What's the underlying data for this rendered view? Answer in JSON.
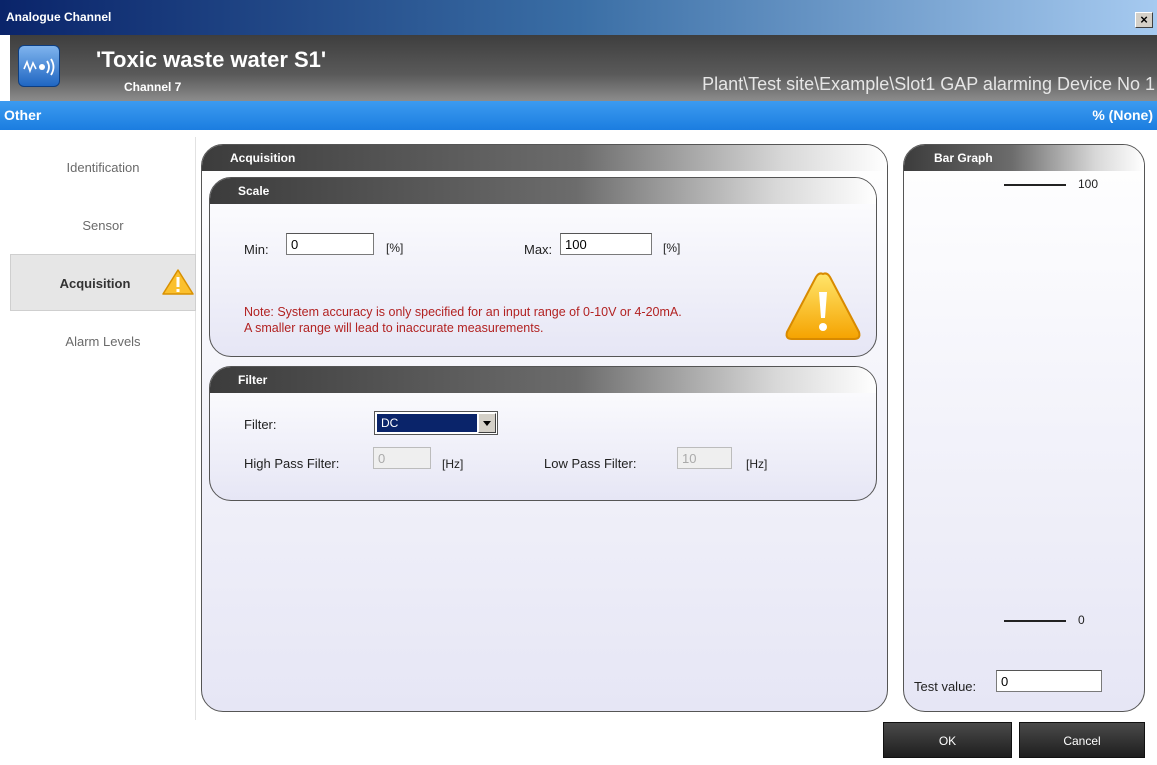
{
  "window": {
    "title": "Analogue Channel",
    "close_label": "×"
  },
  "header": {
    "channel_name": "'Toxic waste water S1'",
    "channel_number": "Channel 7",
    "path": "Plant\\Test site\\Example\\Slot1 GAP alarming Device No 1"
  },
  "subbar": {
    "left": "Other",
    "right": "% (None)"
  },
  "sidebar": {
    "items": [
      {
        "label": "Identification"
      },
      {
        "label": "Sensor"
      },
      {
        "label": "Acquisition",
        "active": true,
        "warning": true
      },
      {
        "label": "Alarm Levels"
      }
    ]
  },
  "acquisition": {
    "title": "Acquisition",
    "scale": {
      "title": "Scale",
      "min_label": "Min:",
      "min_value": "0",
      "min_unit": "[%]",
      "max_label": "Max:",
      "max_value": "100",
      "max_unit": "[%]",
      "note_line1": "Note: System accuracy is only specified for an input range of 0-10V or 4-20mA.",
      "note_line2": "A smaller range will lead to inaccurate measurements."
    },
    "filter": {
      "title": "Filter",
      "filter_label": "Filter:",
      "filter_value": "DC",
      "high_pass_label": "High Pass Filter:",
      "high_pass_value": "0",
      "high_pass_unit": "[Hz]",
      "low_pass_label": "Low Pass Filter:",
      "low_pass_value": "10",
      "low_pass_unit": "[Hz]"
    }
  },
  "bar_graph": {
    "title": "Bar Graph",
    "top_label": "100",
    "bottom_label": "0",
    "test_value_label": "Test value:",
    "test_value": "0"
  },
  "buttons": {
    "ok": "OK",
    "cancel": "Cancel"
  },
  "colors": {
    "accent_blue": "#1b7de0",
    "warning_red": "#b22222",
    "warning_yellow": "#f5b400"
  },
  "icons": {
    "logo": "signal-wave-icon",
    "warning": "warning-triangle-icon",
    "close": "close-icon"
  }
}
